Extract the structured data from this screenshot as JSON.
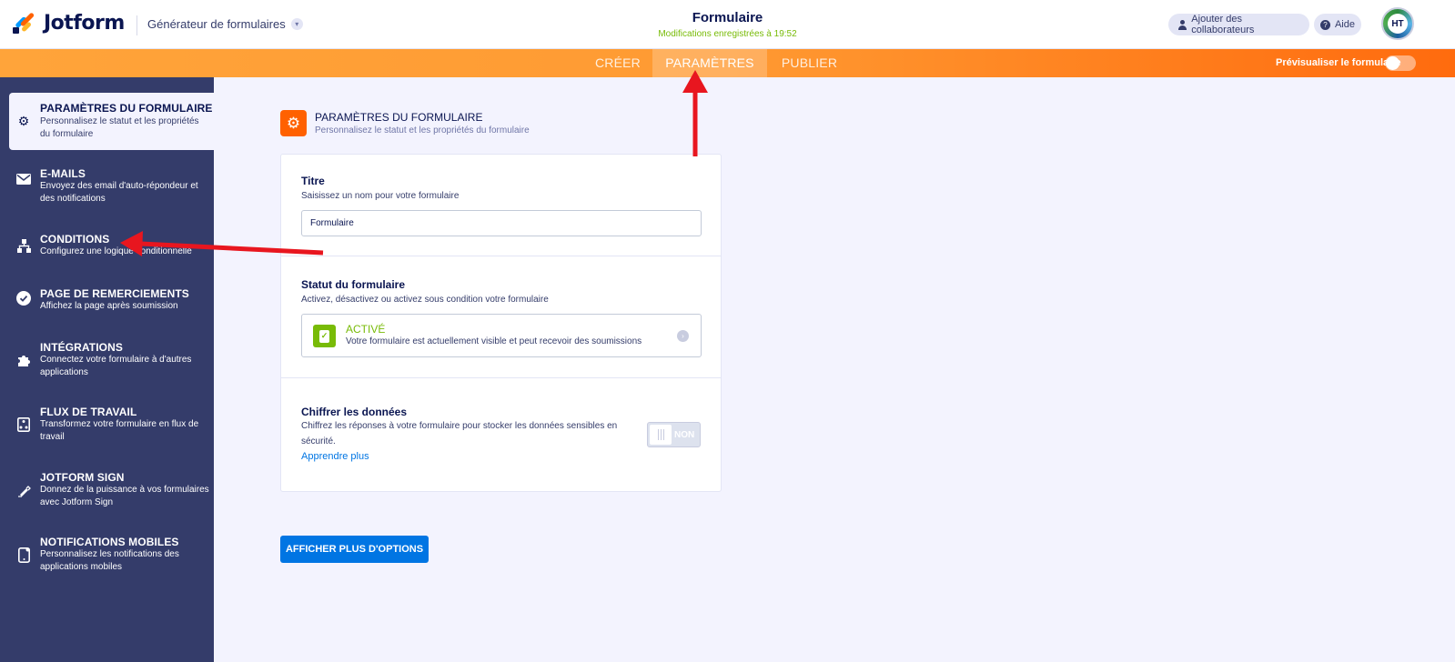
{
  "header": {
    "brand": "Jotform",
    "builder_switch": "Générateur de formulaires",
    "form_title": "Formulaire",
    "saved_status": "Modifications enregistrées à 19:52",
    "add_collaborators": "Ajouter des collaborateurs",
    "help": "Aide",
    "avatar_initials": "HT"
  },
  "nav": {
    "tabs": [
      {
        "label": "CRÉER"
      },
      {
        "label": "PARAMÈTRES"
      },
      {
        "label": "PUBLIER"
      }
    ],
    "active_tab": "PARAMÈTRES",
    "preview_label": "Prévisualiser le formulaire",
    "preview_enabled": false
  },
  "sidebar": {
    "items": [
      {
        "title": "PARAMÈTRES DU FORMULAIRE",
        "desc": "Personnalisez le statut et les propriétés du formulaire",
        "icon": "gear-icon",
        "active": true
      },
      {
        "title": "E-MAILS",
        "desc": "Envoyez des email d'auto-répondeur et des notifications",
        "icon": "envelope-icon"
      },
      {
        "title": "CONDITIONS",
        "desc": "Configurez une logique conditionnelle",
        "icon": "sitemap-icon"
      },
      {
        "title": "PAGE DE REMERCIEMENTS",
        "desc": "Affichez la page après soumission",
        "icon": "check-circle-icon"
      },
      {
        "title": "INTÉGRATIONS",
        "desc": "Connectez votre formulaire à d'autres applications",
        "icon": "puzzle-icon"
      },
      {
        "title": "FLUX DE TRAVAIL",
        "desc": "Transformez votre formulaire en flux de travail",
        "icon": "workflow-icon"
      },
      {
        "title": "JOTFORM SIGN",
        "desc": "Donnez de la puissance à vos formulaires avec Jotform Sign",
        "icon": "pen-icon"
      },
      {
        "title": "NOTIFICATIONS MOBILES",
        "desc": "Personnalisez les notifications des applications mobiles",
        "icon": "mobile-icon"
      }
    ]
  },
  "main": {
    "title": "PARAMÈTRES DU FORMULAIRE",
    "subtitle": "Personnalisez le statut et les propriétés du formulaire",
    "title_field": {
      "label": "Titre",
      "desc": "Saisissez un nom pour votre formulaire",
      "value": "Formulaire"
    },
    "status": {
      "label": "Statut du formulaire",
      "desc": "Activez, désactivez ou activez sous condition votre formulaire",
      "value": "ACTIVÉ",
      "value_desc": "Votre formulaire est actuellement visible et peut recevoir des soumissions"
    },
    "encrypt": {
      "label": "Chiffrer les données",
      "desc": "Chiffrez les réponses à votre formulaire pour stocker les données sensibles en sécurité.",
      "learn_more": "Apprendre plus",
      "toggle_label": "NON",
      "enabled": false
    },
    "more_options": "AFFICHER PLUS D'OPTIONS"
  },
  "colors": {
    "brand_orange": "#ff6100",
    "sidebar_bg": "#343c6a",
    "success_green": "#78bb07",
    "primary_blue": "#0075e3",
    "annotation_red": "#e8161f"
  }
}
